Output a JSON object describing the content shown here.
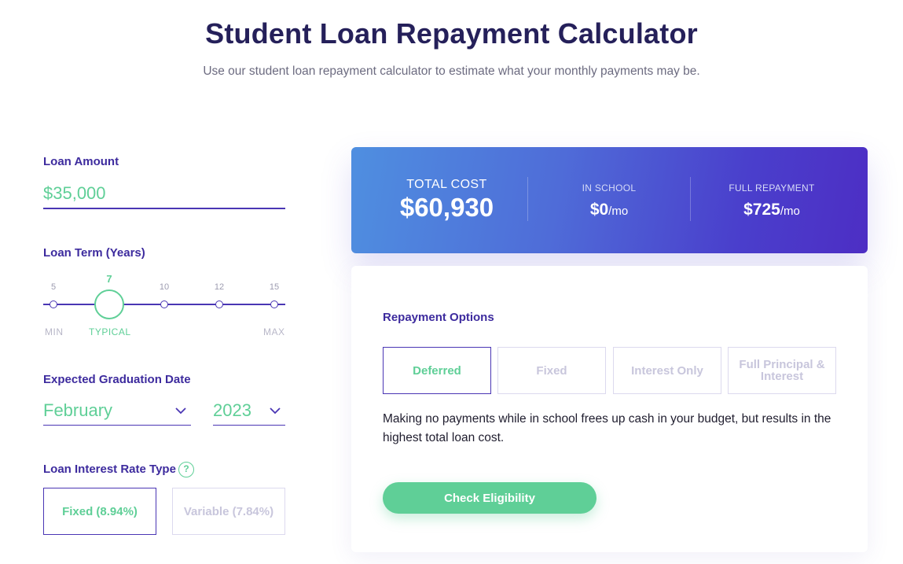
{
  "header": {
    "title": "Student Loan Repayment Calculator",
    "subtitle": "Use our student loan repayment calculator to estimate what your monthly payments may be."
  },
  "form": {
    "loan_amount": {
      "label": "Loan Amount",
      "value": "$35,000"
    },
    "loan_term": {
      "label": "Loan Term (Years)",
      "ticks": [
        "5",
        "7",
        "10",
        "12",
        "15"
      ],
      "selected": "7",
      "captions": {
        "min": "MIN",
        "typical": "TYPICAL",
        "max": "MAX"
      }
    },
    "graduation": {
      "label": "Expected Graduation Date",
      "month": "February",
      "year": "2023"
    },
    "rate_type": {
      "label": "Loan Interest Rate Type",
      "help": "?",
      "options": [
        "Fixed (8.94%)",
        "Variable (7.84%)"
      ],
      "selected": "Fixed (8.94%)"
    }
  },
  "summary": {
    "total_cost_label": "TOTAL COST",
    "total_cost_value": "$60,930",
    "in_school_label": "IN SCHOOL",
    "in_school_value": "$0",
    "full_repayment_label": "FULL REPAYMENT",
    "full_repayment_value": "$725",
    "per_month_unit": "/mo"
  },
  "repayment": {
    "title": "Repayment Options",
    "options": [
      "Deferred",
      "Fixed",
      "Interest Only",
      "Full Principal & Interest"
    ],
    "selected": "Deferred",
    "description": "Making no payments while in school frees up cash in your budget, but results in the highest total loan cost.",
    "cta": "Check Eligibility"
  },
  "colors": {
    "accent_green": "#5fcf97",
    "brand_purple": "#4a36b4",
    "heading_navy": "#25205a"
  }
}
